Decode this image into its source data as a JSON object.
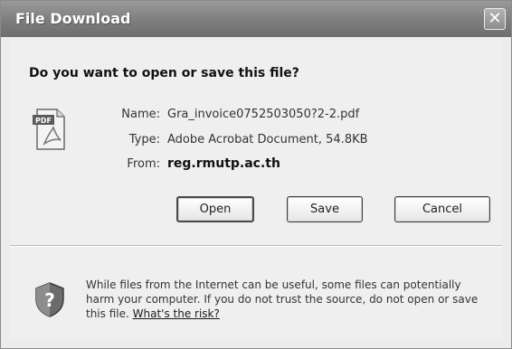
{
  "window": {
    "title": "File Download",
    "close_glyph": "✕"
  },
  "question": "Do you want to open or save this file?",
  "file": {
    "icon": "pdf-file-icon",
    "icon_badge": "PDF",
    "name_label": "Name:",
    "name_value": "Gra_invoice0752503050?2-2.pdf",
    "type_label": "Type:",
    "type_value": "Adobe Acrobat Document, 54.8KB",
    "from_label": "From:",
    "from_value": "reg.rmutp.ac.th"
  },
  "buttons": {
    "open": "Open",
    "save": "Save",
    "cancel": "Cancel"
  },
  "warning": {
    "icon": "shield-question-icon",
    "text": "While files from the Internet can be useful, some files can potentially harm your computer. If you do not trust the source, do not open or save this file. ",
    "link": "What's the risk?"
  }
}
